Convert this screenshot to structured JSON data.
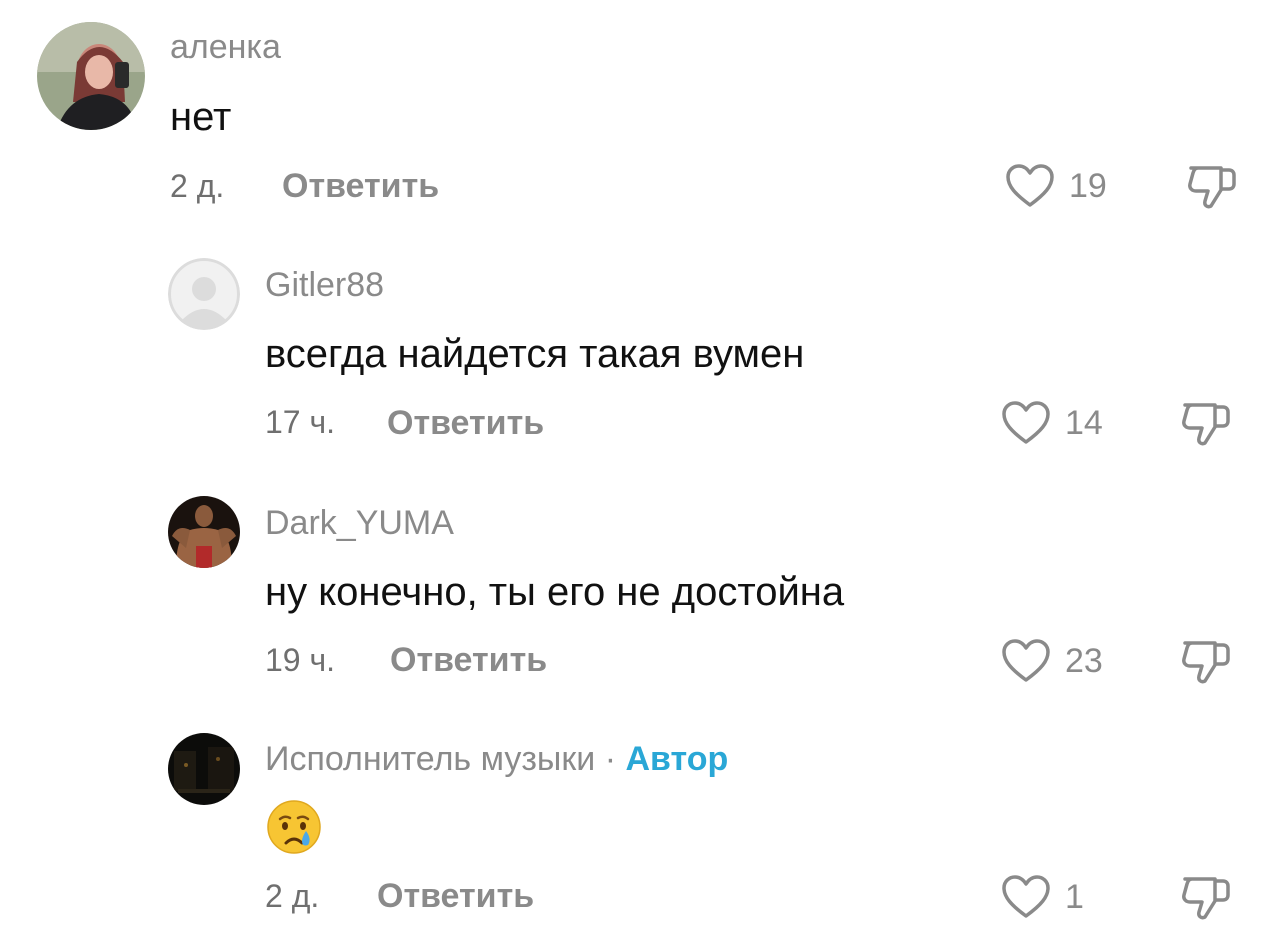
{
  "comments": [
    {
      "username": "аленка",
      "text": "нет",
      "time": "2 д.",
      "reply_label": "Ответить",
      "likes": "19",
      "avatar_icon": "user-photo-avatar",
      "indent": false
    },
    {
      "username": "Gitler88",
      "text": "всегда найдется такая вумен",
      "time": "17 ч.",
      "reply_label": "Ответить",
      "likes": "14",
      "avatar_icon": "default-user-avatar",
      "indent": true
    },
    {
      "username": "Dark_YUMA",
      "text": "ну конечно, ты его не достойна",
      "time": "19 ч.",
      "reply_label": "Ответить",
      "likes": "23",
      "avatar_icon": "user-photo-avatar",
      "indent": true
    },
    {
      "username": "Исполнитель музыки",
      "separator": "·",
      "author_badge": "Автор",
      "text_emoji": "crying-face-emoji",
      "time": "2 д.",
      "reply_label": "Ответить",
      "likes": "1",
      "avatar_icon": "user-photo-avatar",
      "indent": true
    }
  ],
  "icons": {
    "like": "heart-outline-icon",
    "dislike": "thumbs-down-outline-icon"
  },
  "colors": {
    "author_badge": "#2aa7d6",
    "muted_text": "#8a8a8a",
    "body_text": "#111111"
  }
}
